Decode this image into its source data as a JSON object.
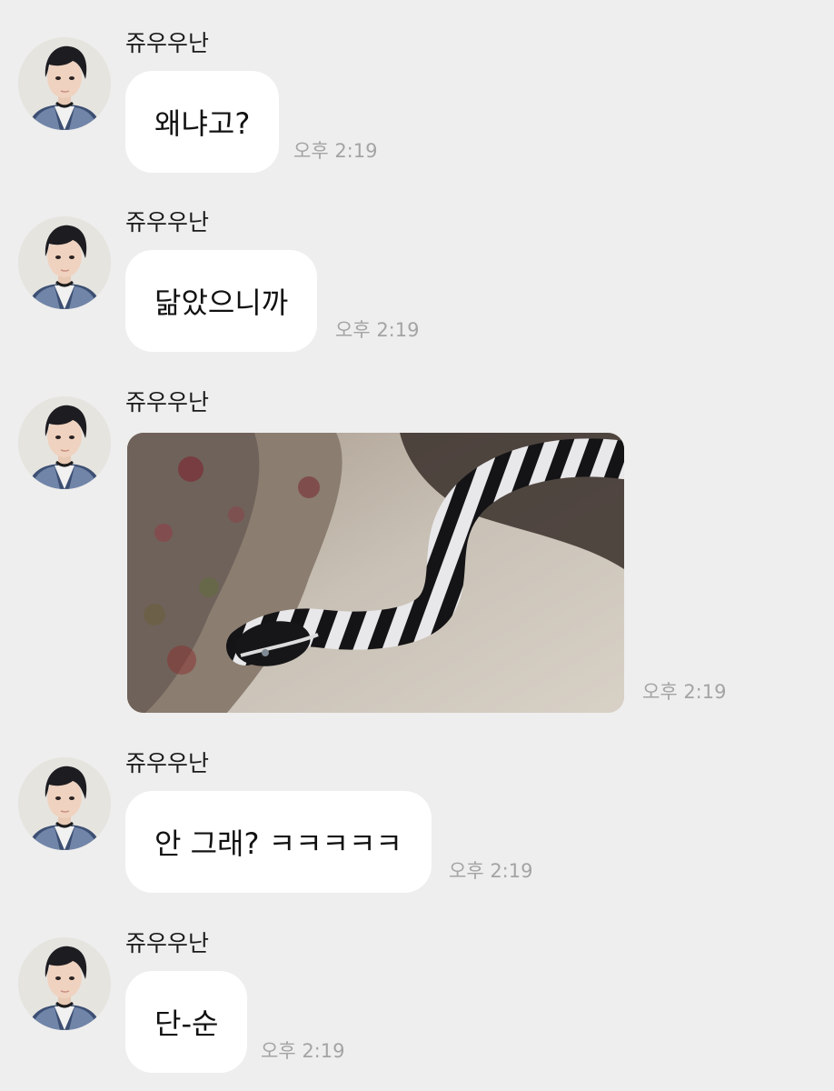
{
  "messages": [
    {
      "sender": "쥬우우난",
      "text": "왜냐고?",
      "time": "오후 2:19"
    },
    {
      "sender": "쥬우우난",
      "text": "닮았으니까",
      "time": "오후 2:19"
    },
    {
      "sender": "쥬우우난",
      "image": "snake-photo",
      "time": "오후 2:19"
    },
    {
      "sender": "쥬우우난",
      "text": "안 그래? ㅋㅋㅋㅋㅋ",
      "time": "오후 2:19"
    },
    {
      "sender": "쥬우우난",
      "text": "단-순",
      "time": "오후 2:19"
    }
  ],
  "colors": {
    "background": "#eeeeee",
    "bubble": "#ffffff",
    "timestamp": "#a4a4a4"
  }
}
